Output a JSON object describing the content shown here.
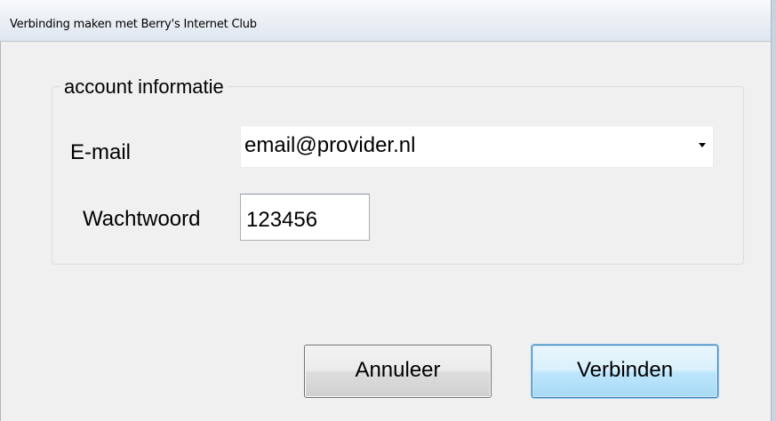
{
  "window": {
    "title": "Verbinding maken met Berry's Internet Club"
  },
  "group": {
    "legend": "account informatie"
  },
  "form": {
    "email_label": "E-mail",
    "email_value": "email@provider.nl",
    "password_label": "Wachtwoord",
    "password_value": "123456"
  },
  "buttons": {
    "cancel_label": "Annuleer",
    "connect_label": "Verbinden"
  },
  "icons": {
    "combo_arrow": "chevron-down-icon"
  },
  "colors": {
    "default_button_border": "#3c7fb1",
    "default_button_fill": "#bee6fd",
    "window_background": "#f0f0f0"
  }
}
